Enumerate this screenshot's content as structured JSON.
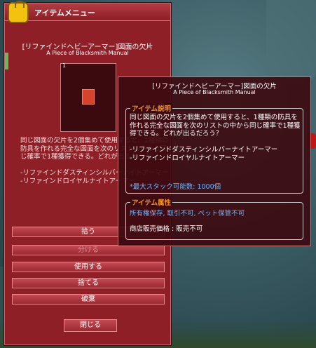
{
  "menu": {
    "title": "アイテムメニュー",
    "item_name": "[リファインドヘビーアーマー]図面の欠片",
    "item_sub": "A Piece of Blacksmith Manual",
    "item_count": "1",
    "description": "同じ図面の欠片を2個集めて使用すると、1種類の防具を作れる完全な図面を次のリストの中から同じ確率で1種獲得できる。どれが出るだろう？\n\n-リファインドダスティンシルバーナイトアーマー\n-リファインドロイヤルナイトアーマー",
    "buttons": [
      {
        "label": "拾う",
        "enabled": true
      },
      {
        "label": "分ける",
        "enabled": false
      },
      {
        "label": "使用する",
        "enabled": true
      },
      {
        "label": "捨てる",
        "enabled": true
      },
      {
        "label": "破棄",
        "enabled": true
      }
    ],
    "close_label": "閉じる"
  },
  "tooltip": {
    "item_name": "[リファインドヘビーアーマー]図面の欠片",
    "item_sub": "A Piece of Blacksmith Manual",
    "desc_header": "アイテム説明",
    "desc_body": "同じ図面の欠片を2個集めて使用すると、1種類の防具を作れる完全な図面を次のリストの中から同じ確率で1種獲得できる。どれが出るだろう？\n\n-リファインドダスティンシルバーナイトアーマー\n-リファインドロイヤルナイトアーマー",
    "stack_info": "*最大スタック可能数: 1000個",
    "attr_header": "アイテム属性",
    "attr_line1": "所有権保存, 取引不可, ペット保管不可",
    "attr_line2": "商店販売価格 : 販売不可"
  },
  "colors": {
    "window_bg": "#8e1f27",
    "tooltip_bg": "#3c0a10",
    "section_header": "#f0902a",
    "info_blue": "#6fb6ff"
  }
}
